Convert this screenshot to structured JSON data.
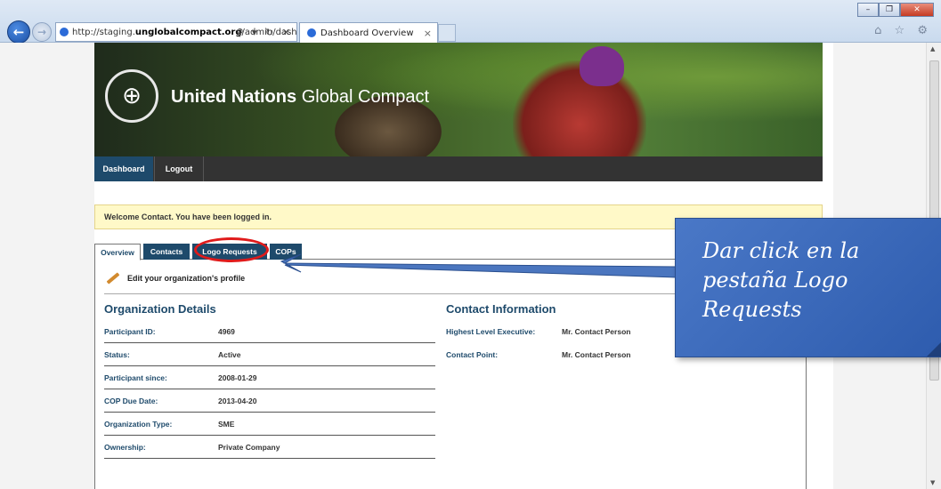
{
  "browser": {
    "url_prefix": "http://staging.",
    "url_domain": "unglobalcompact.org",
    "url_suffix": "/admin/dashb",
    "address_tools": "⚲ ▾ ↻ ✕",
    "tab_title": "Dashboard Overview",
    "tab_close": "×",
    "back": "←",
    "forward": "→",
    "window_buttons": [
      "–",
      "❐",
      "✕"
    ],
    "chrome_icons": "⌂ ☆ ⚙"
  },
  "banner": {
    "brand_bold": "United Nations",
    "brand_light": "Global Compact",
    "logo_icon": "globe-icon"
  },
  "nav": {
    "items": [
      {
        "label": "Dashboard"
      },
      {
        "label": "Logout"
      }
    ]
  },
  "welcome": {
    "text": "Welcome Contact. You have been logged in."
  },
  "tabs": [
    {
      "label": "Overview"
    },
    {
      "label": "Contacts"
    },
    {
      "label": "Logo Requests"
    },
    {
      "label": "COPs"
    }
  ],
  "edit_profile": {
    "label": "Edit your organization's profile",
    "icon": "pencil-icon"
  },
  "organization": {
    "title": "Organization Details",
    "rows": [
      {
        "key": "Participant ID:",
        "value": "4969"
      },
      {
        "key": "Status:",
        "value": "Active"
      },
      {
        "key": "Participant since:",
        "value": "2008-01-29"
      },
      {
        "key": "COP Due Date:",
        "value": "2013-04-20"
      },
      {
        "key": "Organization Type:",
        "value": "SME"
      },
      {
        "key": "Ownership:",
        "value": "Private Company"
      }
    ]
  },
  "contact": {
    "title": "Contact Information",
    "rows": [
      {
        "key": "Highest Level Executive:",
        "value": "Mr. Contact Person"
      },
      {
        "key": "Contact Point:",
        "value": "Mr. Contact Person"
      }
    ]
  },
  "callout": {
    "text": "Dar click en la pestaña Logo Requests"
  },
  "colors": {
    "brand_blue": "#1e4a6b",
    "highlight_red": "#e01b1b",
    "callout_blue": "#3a69bb",
    "welcome_yellow": "#fff9c8"
  }
}
